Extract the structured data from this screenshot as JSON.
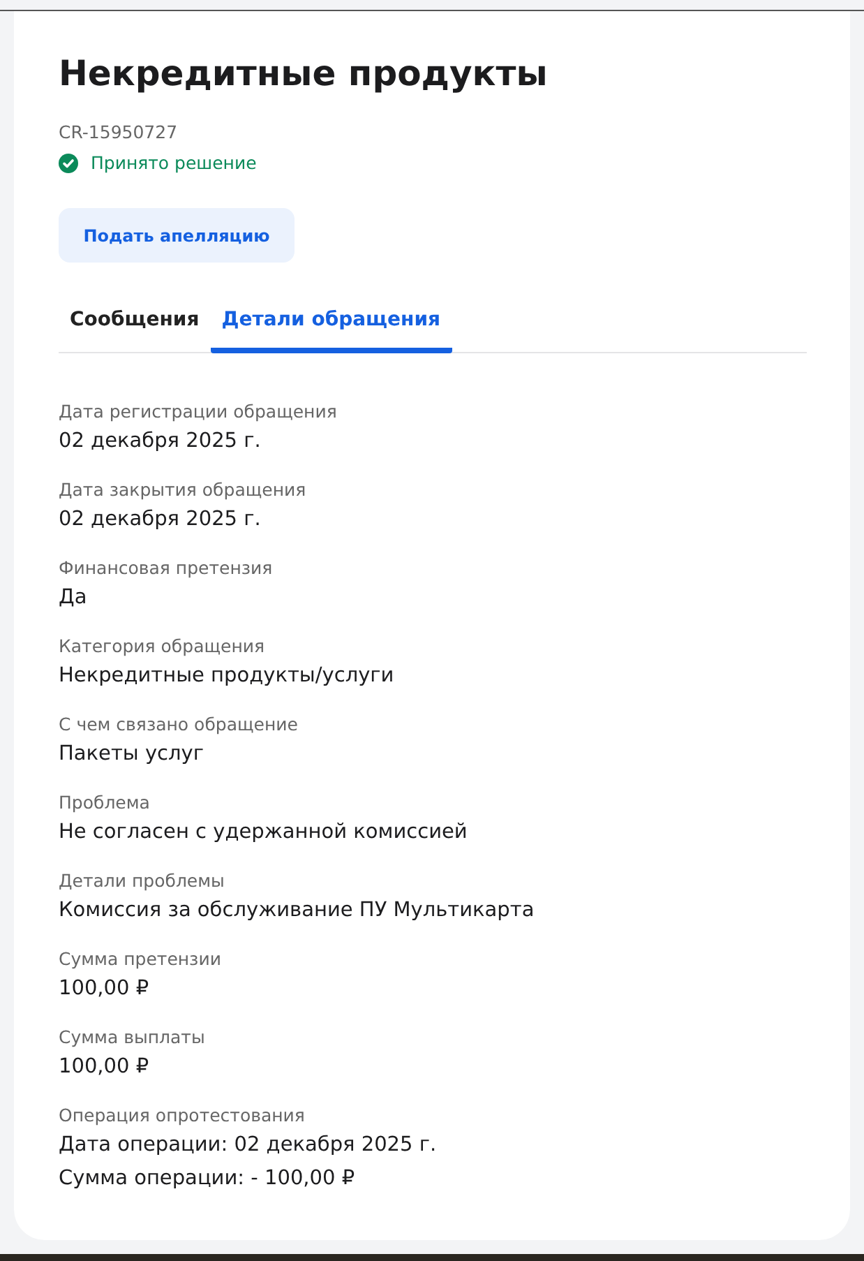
{
  "title": "Некредитные продукты",
  "case_id": "CR-15950727",
  "status": {
    "label": "Принято решение",
    "kind": "resolved"
  },
  "appeal_button": "Подать апелляцию",
  "tabs": [
    {
      "label": "Сообщения",
      "selected": false
    },
    {
      "label": "Детали обращения",
      "selected": true
    }
  ],
  "fields": [
    {
      "label": "Дата регистрации обращения",
      "values": [
        "02 декабря 2025 г."
      ]
    },
    {
      "label": "Дата закрытия обращения",
      "values": [
        "02 декабря 2025 г."
      ]
    },
    {
      "label": "Финансовая претензия",
      "values": [
        "Да"
      ]
    },
    {
      "label": "Категория обращения",
      "values": [
        "Некредитные продукты/услуги"
      ]
    },
    {
      "label": "С чем связано обращение",
      "values": [
        "Пакеты услуг"
      ]
    },
    {
      "label": "Проблема",
      "values": [
        "Не согласен с удержанной комиссией"
      ]
    },
    {
      "label": "Детали проблемы",
      "values": [
        "Комиссия за обслуживание ПУ Мультикарта"
      ]
    },
    {
      "label": "Сумма претензии",
      "values": [
        "100,00 ₽"
      ]
    },
    {
      "label": "Сумма выплаты",
      "values": [
        "100,00 ₽"
      ]
    },
    {
      "label": "Операция опротестования",
      "values": [
        "Дата операции: 02 декабря 2025 г.",
        "Сумма операции: - 100,00 ₽"
      ]
    }
  ]
}
